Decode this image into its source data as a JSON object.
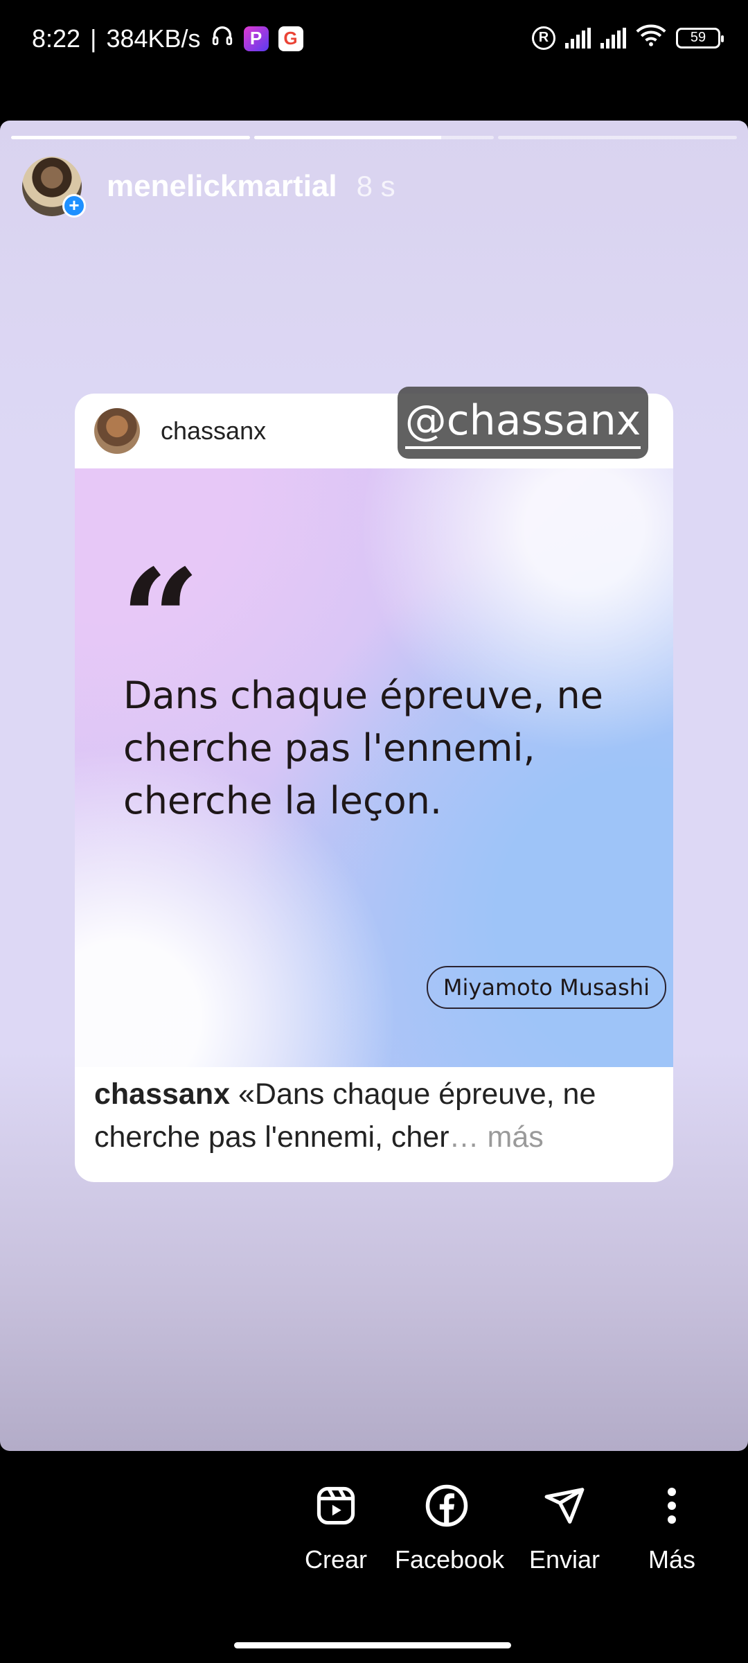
{
  "status_bar": {
    "time": "8:22",
    "separator": "|",
    "speed": "384KB/s",
    "battery": "59",
    "icons": [
      "headphones-icon",
      "p-app-icon",
      "google-icon",
      "registered-icon",
      "signal-icon",
      "signal-icon",
      "wifi-icon",
      "battery-icon"
    ]
  },
  "story": {
    "username": "menelickmartial",
    "time": "8 s",
    "progress": [
      1.0,
      0.78,
      0.0
    ]
  },
  "post": {
    "username": "chassanx",
    "quote_mark": "“",
    "quote": "Dans chaque épreuve, ne cherche pas l'ennemi, cherche la leçon.",
    "author": "Miyamoto Musashi",
    "caption_user": "chassanx",
    "caption_text": " «Dans chaque épreuve, ne cherche pas l'ennemi, cher",
    "caption_more": "… más"
  },
  "mention": {
    "handle": "@chassanx"
  },
  "actions": [
    {
      "label": "Crear",
      "icon": "reels-icon"
    },
    {
      "label": "Facebook",
      "icon": "facebook-icon"
    },
    {
      "label": "Enviar",
      "icon": "send-icon"
    },
    {
      "label": "Más",
      "icon": "more-vertical-icon"
    }
  ],
  "colors": {
    "story_bg": "#ddd8f5",
    "mention_bg": "#505050",
    "plus_badge": "#1e90ff"
  }
}
